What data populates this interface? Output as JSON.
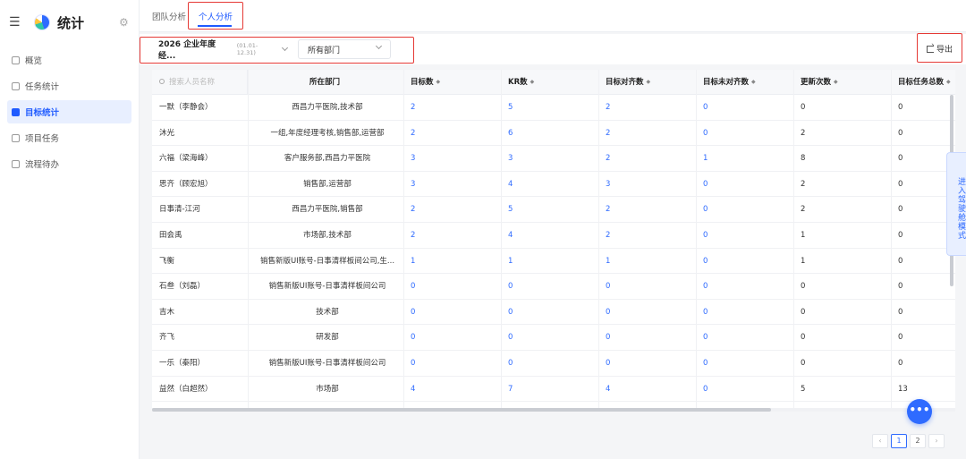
{
  "app": {
    "title": "统计"
  },
  "sidebar": {
    "items": [
      {
        "label": "概览",
        "icon": "overview-icon",
        "active": false
      },
      {
        "label": "任务统计",
        "icon": "task-stats-icon",
        "active": false
      },
      {
        "label": "目标统计",
        "icon": "goal-stats-icon",
        "active": true
      },
      {
        "label": "项目任务",
        "icon": "project-task-icon",
        "active": false
      },
      {
        "label": "流程待办",
        "icon": "workflow-todo-icon",
        "active": false
      }
    ]
  },
  "tabs": [
    {
      "label": "团队分析",
      "active": false
    },
    {
      "label": "个人分析",
      "active": true
    }
  ],
  "filters": {
    "period": {
      "value": "2026 企业年度经...",
      "dates": "(01.01-12.31)"
    },
    "department": {
      "value": "所有部门"
    },
    "export_label": "导出"
  },
  "table": {
    "search_placeholder": "搜索人员名称",
    "columns": [
      "所在部门",
      "目标数",
      "KR数",
      "目标对齐数",
      "目标未对齐数",
      "更新次数",
      "目标任务总数"
    ],
    "rows": [
      {
        "name": "一默（李静会）",
        "dept": "西昌力平医院,技术部",
        "goals": "2",
        "kr": "5",
        "aligned": "2",
        "unaligned": "0",
        "updates": "0",
        "tasks": "0"
      },
      {
        "name": "沐光",
        "dept": "一组,年度经理考核,销售部,运营部",
        "goals": "2",
        "kr": "6",
        "aligned": "2",
        "unaligned": "0",
        "updates": "2",
        "tasks": "0"
      },
      {
        "name": "六福（梁海峰）",
        "dept": "客户服务部,西昌力平医院",
        "goals": "3",
        "kr": "3",
        "aligned": "2",
        "unaligned": "1",
        "updates": "8",
        "tasks": "0"
      },
      {
        "name": "思齐（顾宏旭）",
        "dept": "销售部,运营部",
        "goals": "3",
        "kr": "4",
        "aligned": "3",
        "unaligned": "0",
        "updates": "2",
        "tasks": "0"
      },
      {
        "name": "日事清-江河",
        "dept": "西昌力平医院,销售部",
        "goals": "2",
        "kr": "5",
        "aligned": "2",
        "unaligned": "0",
        "updates": "2",
        "tasks": "0"
      },
      {
        "name": "田会禹",
        "dept": "市场部,技术部",
        "goals": "2",
        "kr": "4",
        "aligned": "2",
        "unaligned": "0",
        "updates": "1",
        "tasks": "0"
      },
      {
        "name": "飞衡",
        "dept": "销售新版UI账号-日事清样板间公司,生...",
        "goals": "1",
        "kr": "1",
        "aligned": "1",
        "unaligned": "0",
        "updates": "1",
        "tasks": "0"
      },
      {
        "name": "石叁（刘磊）",
        "dept": "销售新版UI账号-日事清样板间公司",
        "goals": "0",
        "kr": "0",
        "aligned": "0",
        "unaligned": "0",
        "updates": "0",
        "tasks": "0"
      },
      {
        "name": "吉木",
        "dept": "技术部",
        "goals": "0",
        "kr": "0",
        "aligned": "0",
        "unaligned": "0",
        "updates": "0",
        "tasks": "0"
      },
      {
        "name": "齐飞",
        "dept": "研发部",
        "goals": "0",
        "kr": "0",
        "aligned": "0",
        "unaligned": "0",
        "updates": "0",
        "tasks": "0"
      },
      {
        "name": "一乐（秦阳）",
        "dept": "销售新版UI账号-日事清样板间公司",
        "goals": "0",
        "kr": "0",
        "aligned": "0",
        "unaligned": "0",
        "updates": "0",
        "tasks": "0"
      },
      {
        "name": "益然（白超然）",
        "dept": "市场部",
        "goals": "4",
        "kr": "7",
        "aligned": "4",
        "unaligned": "0",
        "updates": "5",
        "tasks": "13"
      }
    ]
  },
  "side_tab": {
    "label": "进入驾驶舱模式"
  },
  "fab": {
    "label": "•••"
  },
  "pagination": {
    "prev": "‹",
    "next": "›",
    "pages": [
      "1",
      "2"
    ],
    "current": "1"
  },
  "colors": {
    "accent": "#2f6bff",
    "annotation": "#e53935"
  }
}
